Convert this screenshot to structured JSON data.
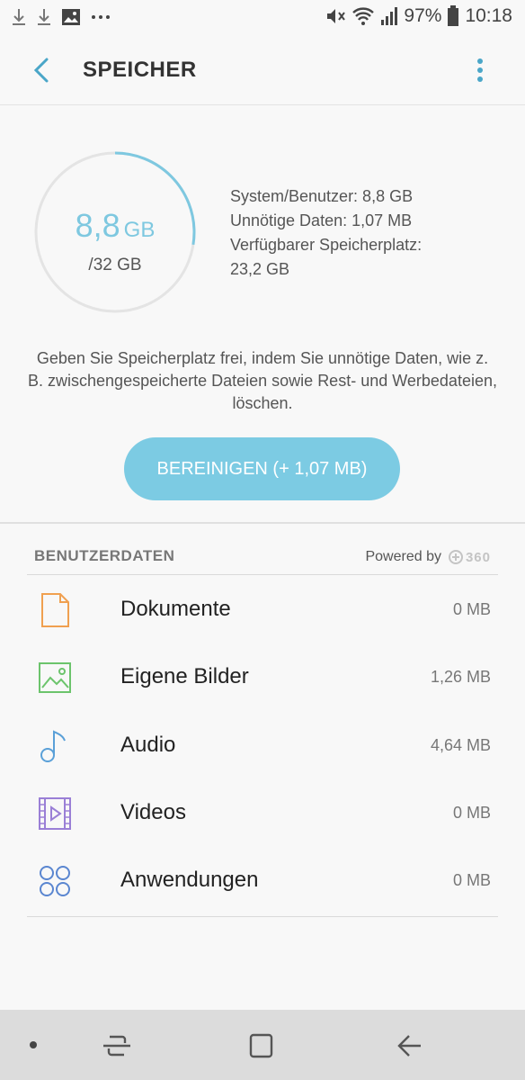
{
  "statusbar": {
    "battery": "97%",
    "time": "10:18",
    "left_icons": [
      "download-icon",
      "download-icon",
      "image-icon",
      "more-dots-icon"
    ],
    "right_icons": [
      "mute-icon",
      "wifi-icon",
      "signal-icon",
      "battery-icon"
    ]
  },
  "appbar": {
    "title": "SPEICHER",
    "back_icon": "back-chevron-icon",
    "menu_icon": "more-vert-icon"
  },
  "storage": {
    "used_value": "8,8",
    "used_unit": "GB",
    "total": "/32 GB",
    "used_fraction": 0.275,
    "ring_color": "#7ec8e0",
    "stats": {
      "system": "System/Benutzer: 8,8 GB",
      "junk": "Unnötige Daten: 1,07 MB",
      "free_label": "Verfügbarer Speicherplatz:",
      "free_value": "23,2 GB"
    },
    "description": "Geben Sie Speicherplatz frei, indem Sie unnötige Daten, wie z. B. zwischengespeicherte Dateien sowie Rest- und Werbedateien, löschen.",
    "clean_button": "BEREINIGEN (+ 1,07 MB)",
    "accent_color": "#7ccbe3"
  },
  "user_data": {
    "header": "BENUTZERDATEN",
    "powered_by": "Powered by",
    "powered_logo": "360",
    "items": [
      {
        "label": "Dokumente",
        "size": "0 MB",
        "icon": "document-icon",
        "color": "#f0a050"
      },
      {
        "label": "Eigene Bilder",
        "size": "1,26 MB",
        "icon": "image-icon",
        "color": "#6cc46c"
      },
      {
        "label": "Audio",
        "size": "4,64 MB",
        "icon": "music-note-icon",
        "color": "#5aa0d8"
      },
      {
        "label": "Videos",
        "size": "0 MB",
        "icon": "video-icon",
        "color": "#9a7fd6"
      },
      {
        "label": "Anwendungen",
        "size": "0 MB",
        "icon": "apps-icon",
        "color": "#5a86d0"
      }
    ]
  },
  "navbar": {
    "icons": [
      "dot-icon",
      "recent-apps-icon",
      "home-icon",
      "back-icon"
    ]
  }
}
